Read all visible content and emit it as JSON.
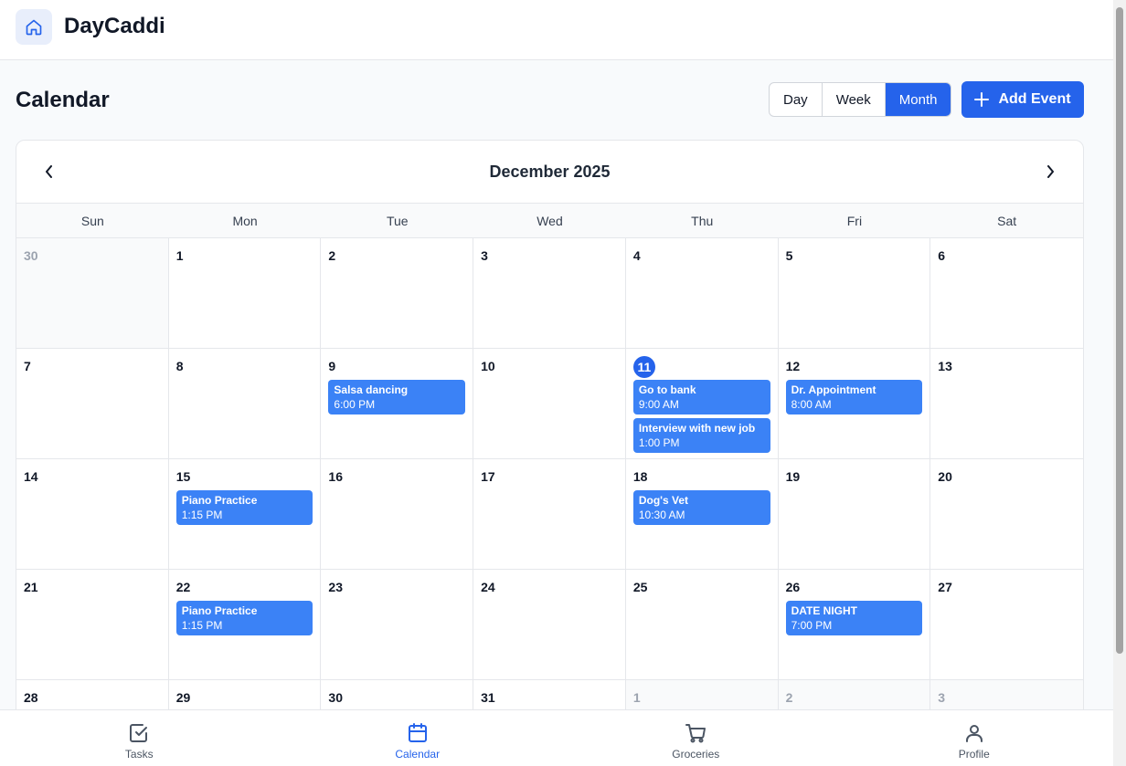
{
  "app": {
    "name": "DayCaddi",
    "logo_icon": "home-icon"
  },
  "page": {
    "title": "Calendar"
  },
  "view_toggle": {
    "options": [
      "Day",
      "Week",
      "Month"
    ],
    "active": "Month"
  },
  "add_event": {
    "label": "Add Event",
    "icon": "plus-icon"
  },
  "calendar": {
    "month_label": "December 2025",
    "weekdays": [
      "Sun",
      "Mon",
      "Tue",
      "Wed",
      "Thu",
      "Fri",
      "Sat"
    ],
    "today": 11,
    "days": [
      {
        "day": "30",
        "outside": true
      },
      {
        "day": "1"
      },
      {
        "day": "2"
      },
      {
        "day": "3"
      },
      {
        "day": "4"
      },
      {
        "day": "5"
      },
      {
        "day": "6"
      },
      {
        "day": "7"
      },
      {
        "day": "8"
      },
      {
        "day": "9",
        "events": [
          {
            "title": "Salsa dancing",
            "time": "6:00 PM"
          }
        ]
      },
      {
        "day": "10"
      },
      {
        "day": "11",
        "today": true,
        "events": [
          {
            "title": "Go to bank",
            "time": "9:00 AM"
          },
          {
            "title": "Interview with new job",
            "time": "1:00 PM"
          }
        ]
      },
      {
        "day": "12",
        "events": [
          {
            "title": "Dr. Appointment",
            "time": "8:00 AM"
          }
        ]
      },
      {
        "day": "13"
      },
      {
        "day": "14"
      },
      {
        "day": "15",
        "events": [
          {
            "title": "Piano Practice",
            "time": "1:15 PM"
          }
        ]
      },
      {
        "day": "16"
      },
      {
        "day": "17"
      },
      {
        "day": "18",
        "events": [
          {
            "title": "Dog's Vet",
            "time": "10:30 AM"
          }
        ]
      },
      {
        "day": "19"
      },
      {
        "day": "20"
      },
      {
        "day": "21"
      },
      {
        "day": "22",
        "events": [
          {
            "title": "Piano Practice",
            "time": "1:15 PM"
          }
        ]
      },
      {
        "day": "23"
      },
      {
        "day": "24"
      },
      {
        "day": "25"
      },
      {
        "day": "26",
        "events": [
          {
            "title": "DATE NIGHT",
            "time": "7:00 PM"
          }
        ]
      },
      {
        "day": "27"
      },
      {
        "day": "28"
      },
      {
        "day": "29"
      },
      {
        "day": "30"
      },
      {
        "day": "31"
      },
      {
        "day": "1",
        "outside": true
      },
      {
        "day": "2",
        "outside": true
      },
      {
        "day": "3",
        "outside": true
      }
    ]
  },
  "bottom_nav": [
    {
      "label": "Tasks",
      "icon": "checkbox-icon",
      "active": false
    },
    {
      "label": "Calendar",
      "icon": "calendar-icon",
      "active": true
    },
    {
      "label": "Groceries",
      "icon": "cart-icon",
      "active": false
    },
    {
      "label": "Profile",
      "icon": "user-icon",
      "active": false
    }
  ],
  "colors": {
    "primary": "#2563eb",
    "event": "#3b82f6",
    "border": "#e5e7eb",
    "muted": "#9ca3af"
  }
}
